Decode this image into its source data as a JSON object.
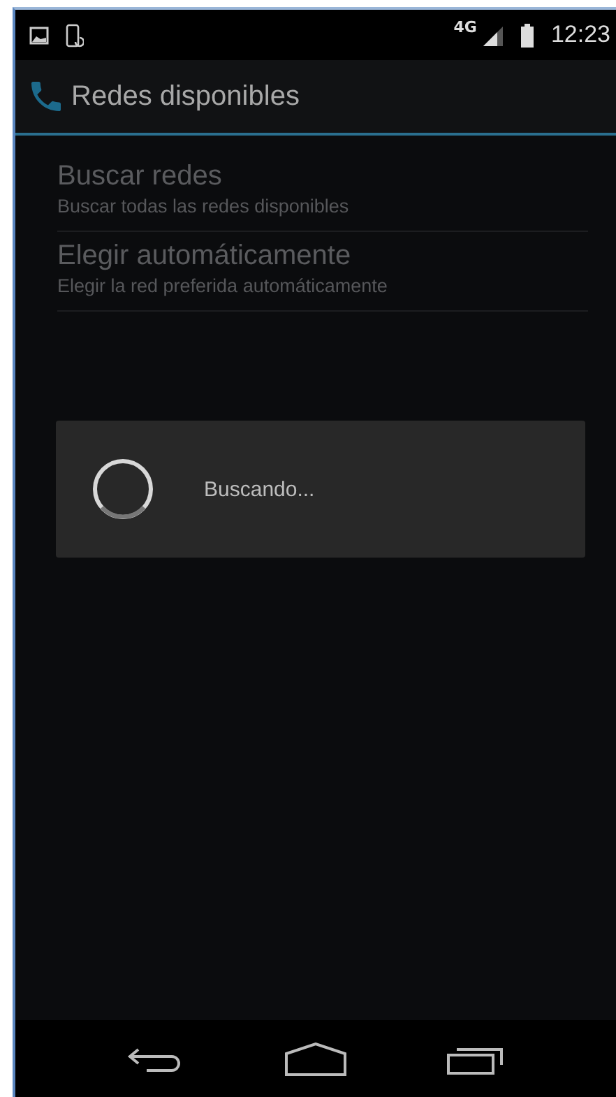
{
  "status_bar": {
    "network": "4G",
    "time": "12:23"
  },
  "action_bar": {
    "title": "Redes disponibles"
  },
  "settings": [
    {
      "title": "Buscar redes",
      "summary": "Buscar todas las redes disponibles",
      "disabled": true
    },
    {
      "title": "Elegir automáticamente",
      "summary": "Elegir la red preferida automáticamente",
      "disabled": true
    }
  ],
  "progress_dialog": {
    "message": "Buscando..."
  }
}
